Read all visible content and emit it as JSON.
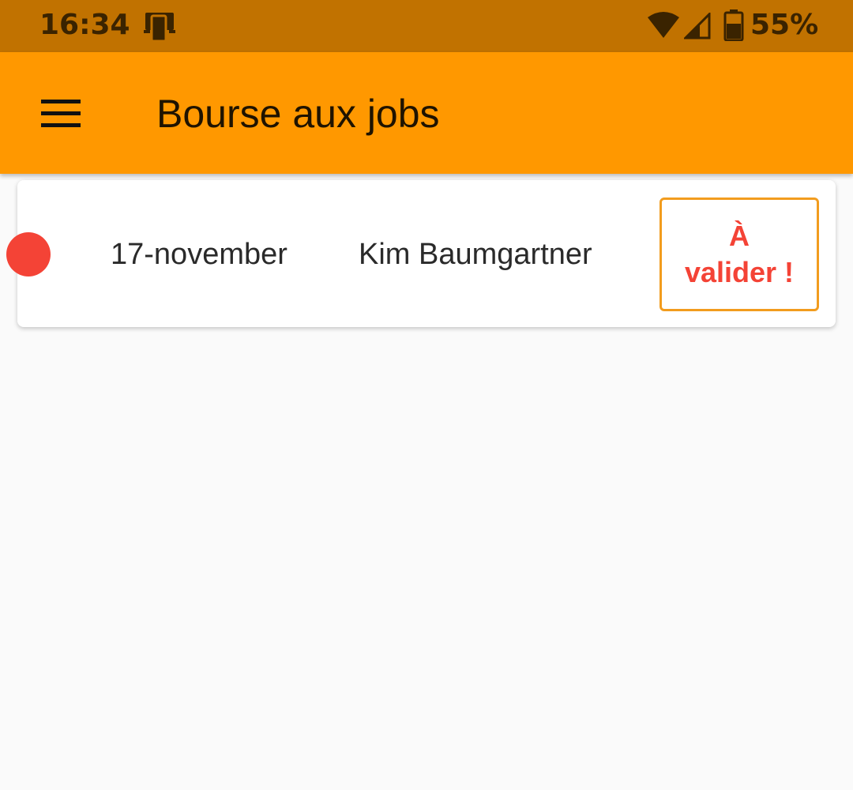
{
  "status_bar": {
    "time": "16:34",
    "battery": "55%",
    "icons": [
      "notification-device-icon",
      "wifi-icon",
      "cell-signal-icon",
      "battery-icon"
    ],
    "background": "#c17200"
  },
  "app_bar": {
    "title": "Bourse aux jobs",
    "menu_icon": "hamburger-menu-icon",
    "background": "#ff9800"
  },
  "jobs": [
    {
      "status_color": "#f44336",
      "date": "17-november",
      "name": "Kim Baumgartner",
      "action_label": "À\nvalider !",
      "action_border_color": "#f29c1e",
      "action_text_color": "#f44336"
    }
  ]
}
